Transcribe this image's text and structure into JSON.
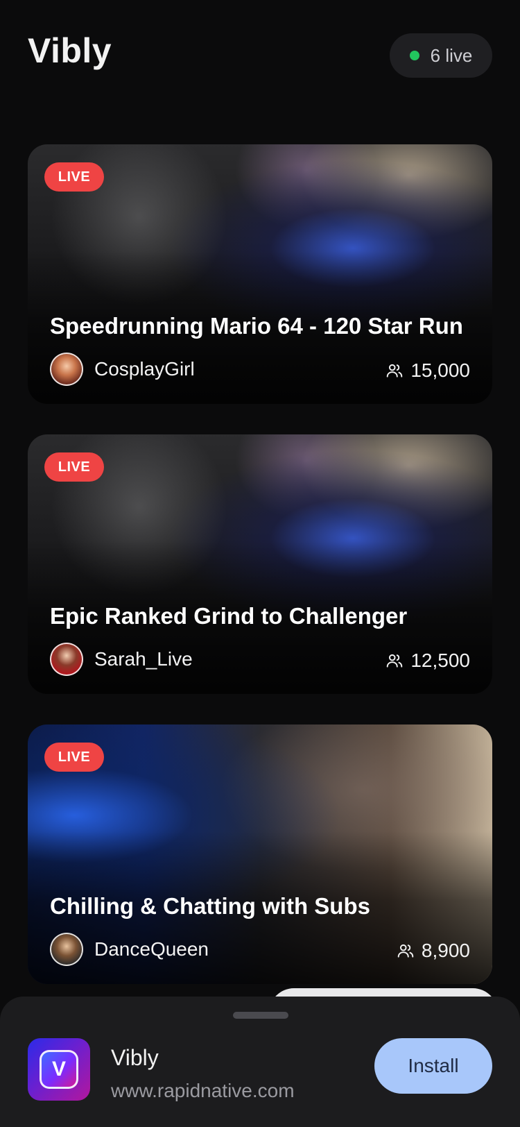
{
  "header": {
    "title": "Vibly",
    "live_count": "6 live"
  },
  "streams": [
    {
      "badge": "LIVE",
      "title": "Speedrunning Mario 64 - 120 Star Run",
      "streamer": "CosplayGirl",
      "viewers": "15,000"
    },
    {
      "badge": "LIVE",
      "title": "Epic Ranked Grind to Challenger",
      "streamer": "Sarah_Live",
      "viewers": "12,500"
    },
    {
      "badge": "LIVE",
      "title": "Chilling & Chatting with Subs",
      "streamer": "DanceQueen",
      "viewers": "8,900"
    }
  ],
  "install_sheet": {
    "app_name": "Vibly",
    "app_url": "www.rapidnative.com",
    "install_label": "Install",
    "icon_letter": "V"
  },
  "colors": {
    "live_badge": "#ef4444",
    "live_dot": "#22c55e",
    "install_button": "#a8c7fa"
  },
  "icons": {
    "viewers": "users-icon",
    "live_indicator": "dot-icon"
  }
}
